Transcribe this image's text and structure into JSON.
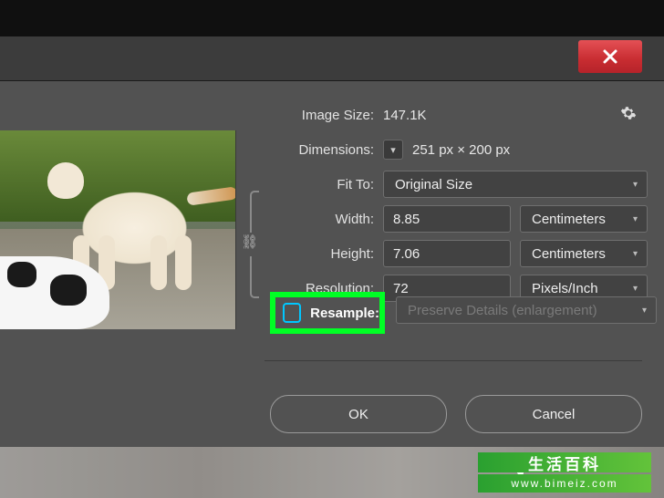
{
  "dialog": {
    "close_aria": "Close",
    "gear_aria": "Settings",
    "size_label": "Image Size:",
    "size_value": "147.1K",
    "dim_label": "Dimensions:",
    "dim_value": "251 px  ×  200 px",
    "fit_label": "Fit To:",
    "fit_value": "Original Size",
    "width_label": "Width:",
    "width_value": "8.85",
    "width_unit": "Centimeters",
    "height_label": "Height:",
    "height_value": "7.06",
    "height_unit": "Centimeters",
    "res_label": "Resolution:",
    "res_value": "72",
    "res_unit": "Pixels/Inch",
    "resample_label": "Resample:",
    "resample_method": "Preserve Details (enlargement)",
    "resample_checked": false,
    "ok_label": "OK",
    "cancel_label": "Cancel"
  },
  "watermark": {
    "line1": "生活百科",
    "line2": "www.bimeiz.com"
  }
}
